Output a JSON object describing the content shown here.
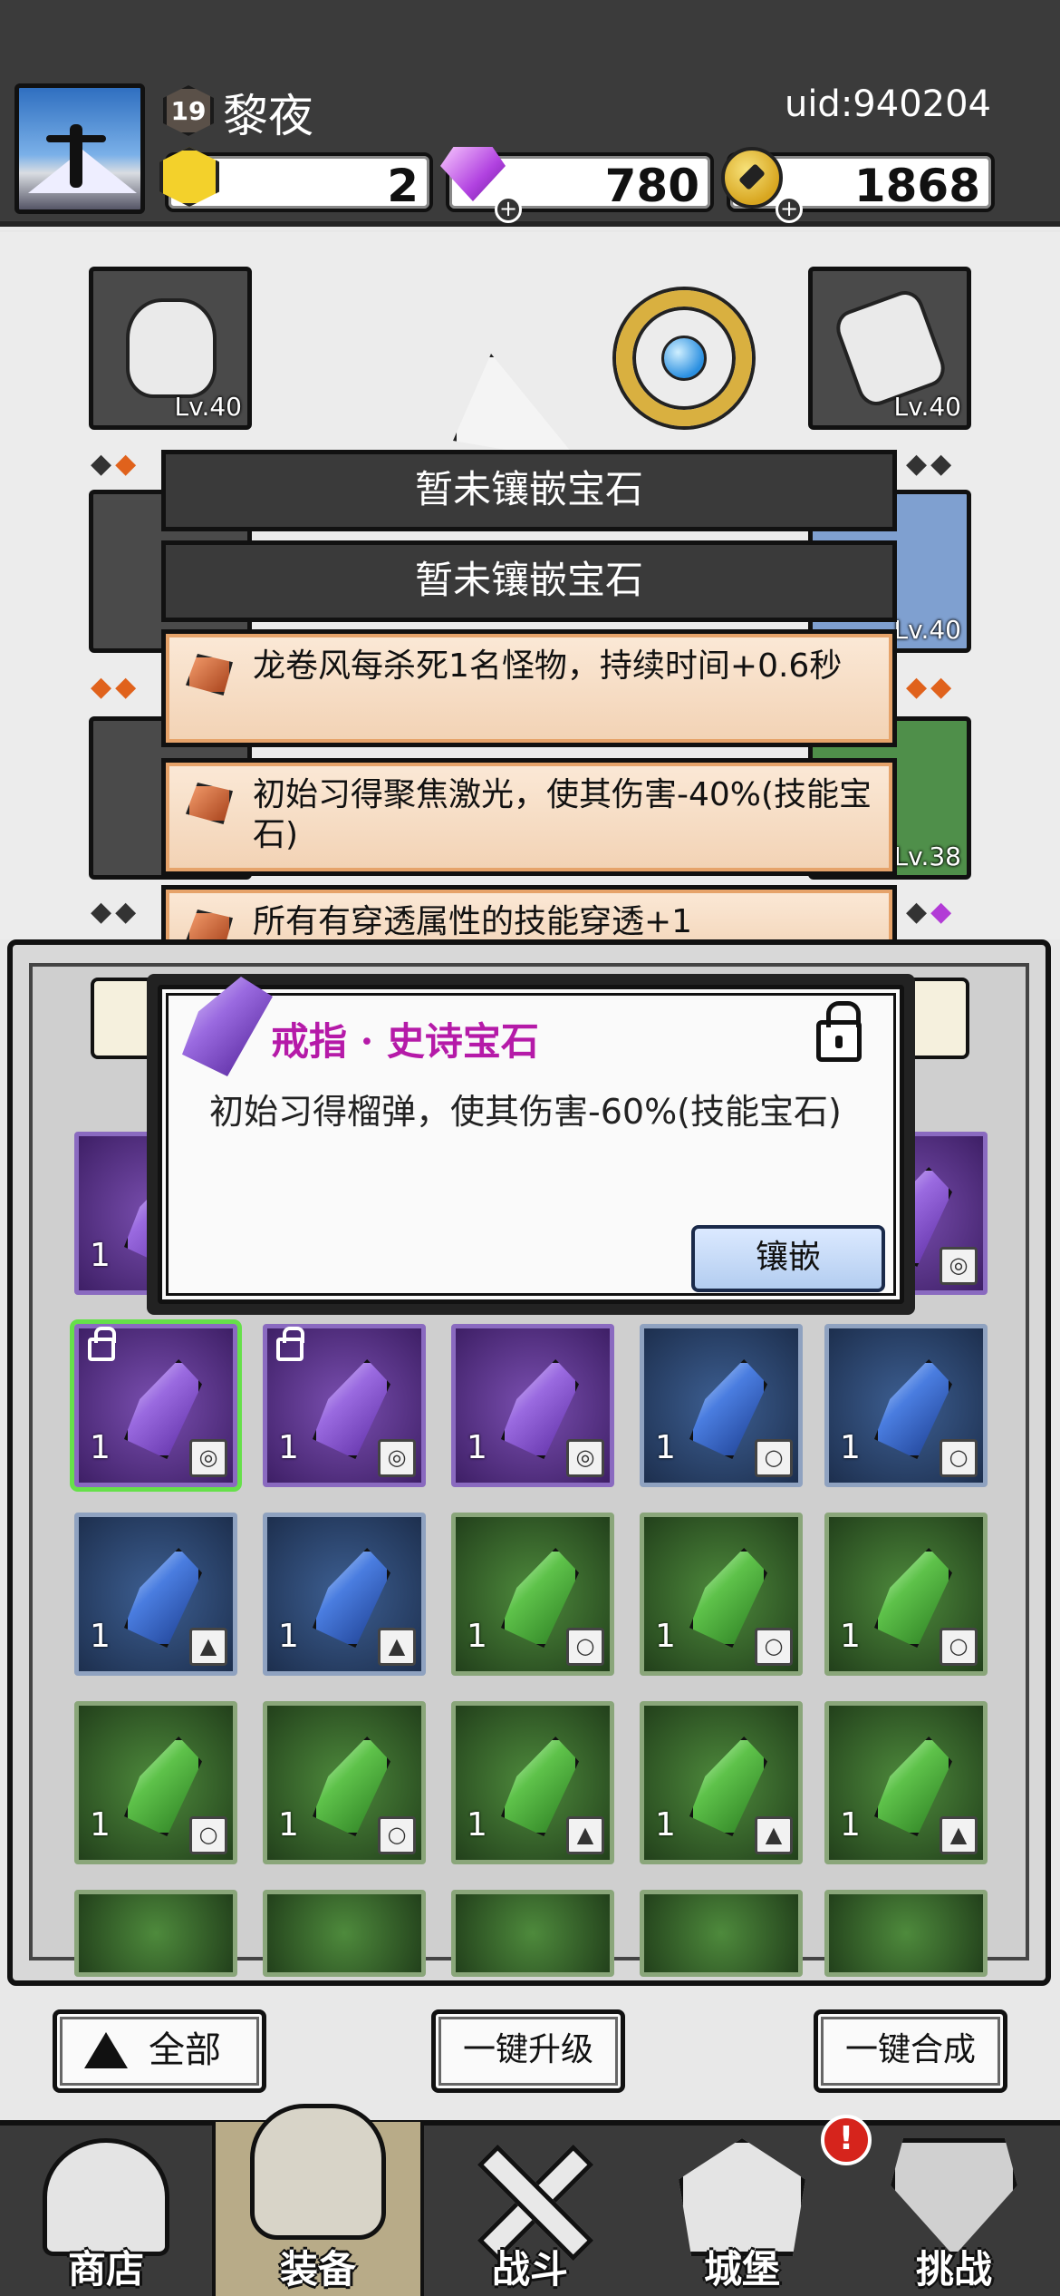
{
  "player": {
    "level": "19",
    "name": "黎夜",
    "uid": "uid:940204"
  },
  "resources": {
    "energy": "2",
    "diamonds": "780",
    "gold": "1868"
  },
  "equipment": {
    "slots": [
      {
        "level": "Lv.40"
      },
      {
        "level": "Lv.40"
      },
      {
        "level": "Lv.40"
      },
      {
        "level": "Lv.38"
      }
    ]
  },
  "sockets": [
    {
      "text": "暂未镶嵌宝石"
    },
    {
      "text": "暂未镶嵌宝石"
    },
    {
      "text": "龙卷风每杀死1名怪物，持续时间+0.6秒"
    },
    {
      "text": "初始习得聚焦激光，使其伤害-40%(技能宝石)"
    },
    {
      "text": "所有有穿透属性的技能穿透+1"
    }
  ],
  "detail": {
    "title": "戒指 · 史诗宝石",
    "description": "初始习得榴弹，使其伤害-60%(技能宝石)",
    "inlay_button": "镶嵌"
  },
  "inventory_count": "1",
  "bottom_buttons": {
    "all": "全部",
    "upgrade_all": "一键升级",
    "merge_all": "一键合成"
  },
  "nav": {
    "shop": "商店",
    "equipment": "装备",
    "battle": "战斗",
    "castle": "城堡",
    "challenge": "挑战",
    "alert": "!"
  },
  "colors": {
    "header_bg": "#3b3b3b",
    "epic_purple": "#b51aa8",
    "selected_green": "#66e04a",
    "alert_red": "#d6241c"
  }
}
